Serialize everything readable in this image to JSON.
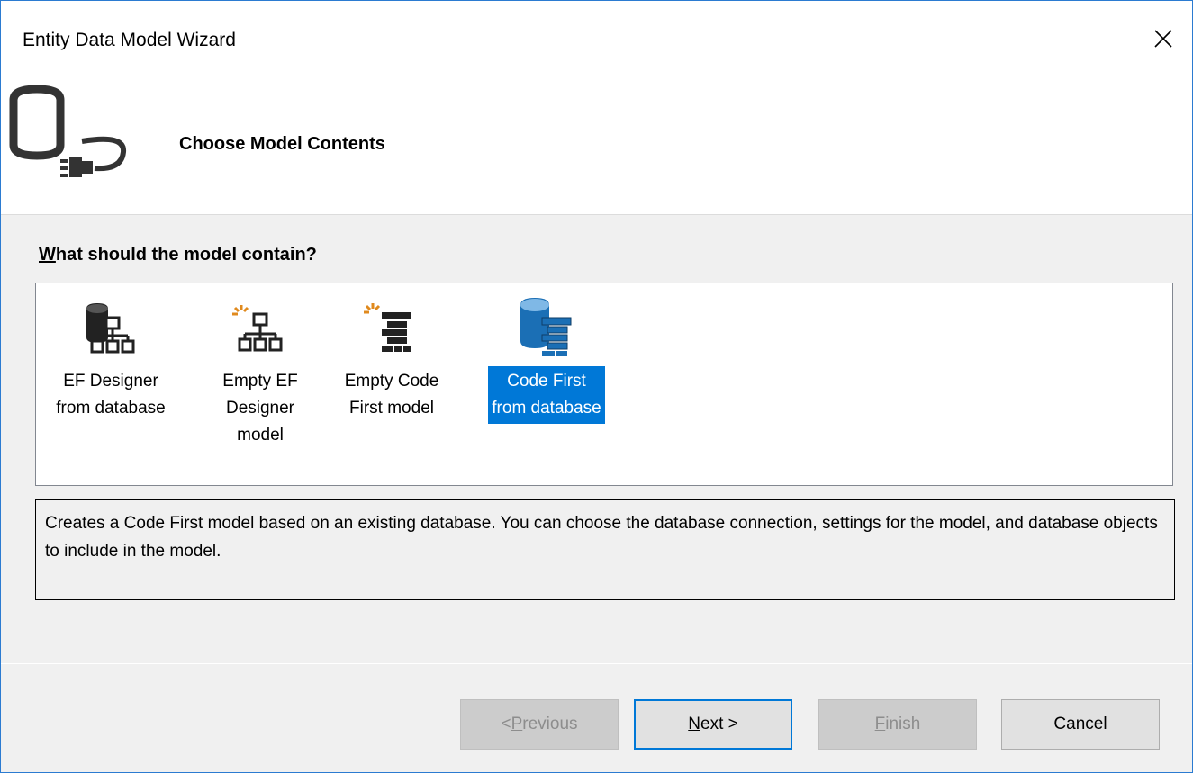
{
  "window": {
    "title": "Entity Data Model Wizard",
    "close_label": "✕"
  },
  "header": {
    "title": "Choose Model Contents",
    "icon": "database-plug-icon"
  },
  "question": {
    "mnemonic": "W",
    "rest": "hat should the model contain?"
  },
  "choices": [
    {
      "label": "EF Designer from database",
      "icon": "ef-designer-database-icon",
      "selected": false
    },
    {
      "label": "Empty EF Designer model",
      "icon": "empty-ef-designer-icon",
      "selected": false
    },
    {
      "label": "Empty Code First model",
      "icon": "empty-code-first-icon",
      "selected": false
    },
    {
      "label": "Code First from database",
      "icon": "code-first-database-icon",
      "selected": true
    }
  ],
  "description": "Creates a Code First model based on an existing database. You can choose the database connection, settings for the model, and database objects to include in the model.",
  "buttons": {
    "previous": {
      "prefix": "< ",
      "mnemonic": "P",
      "rest": "revious",
      "enabled": false
    },
    "next": {
      "mnemonic": "N",
      "rest": "ext >",
      "enabled": true
    },
    "finish": {
      "mnemonic": "F",
      "rest": "inish",
      "enabled": false
    },
    "cancel": {
      "label": "Cancel",
      "enabled": true
    }
  },
  "colors": {
    "selection": "#0078d7",
    "window_border": "#2b7bd1",
    "dialog_bg": "#f0f0f0"
  }
}
